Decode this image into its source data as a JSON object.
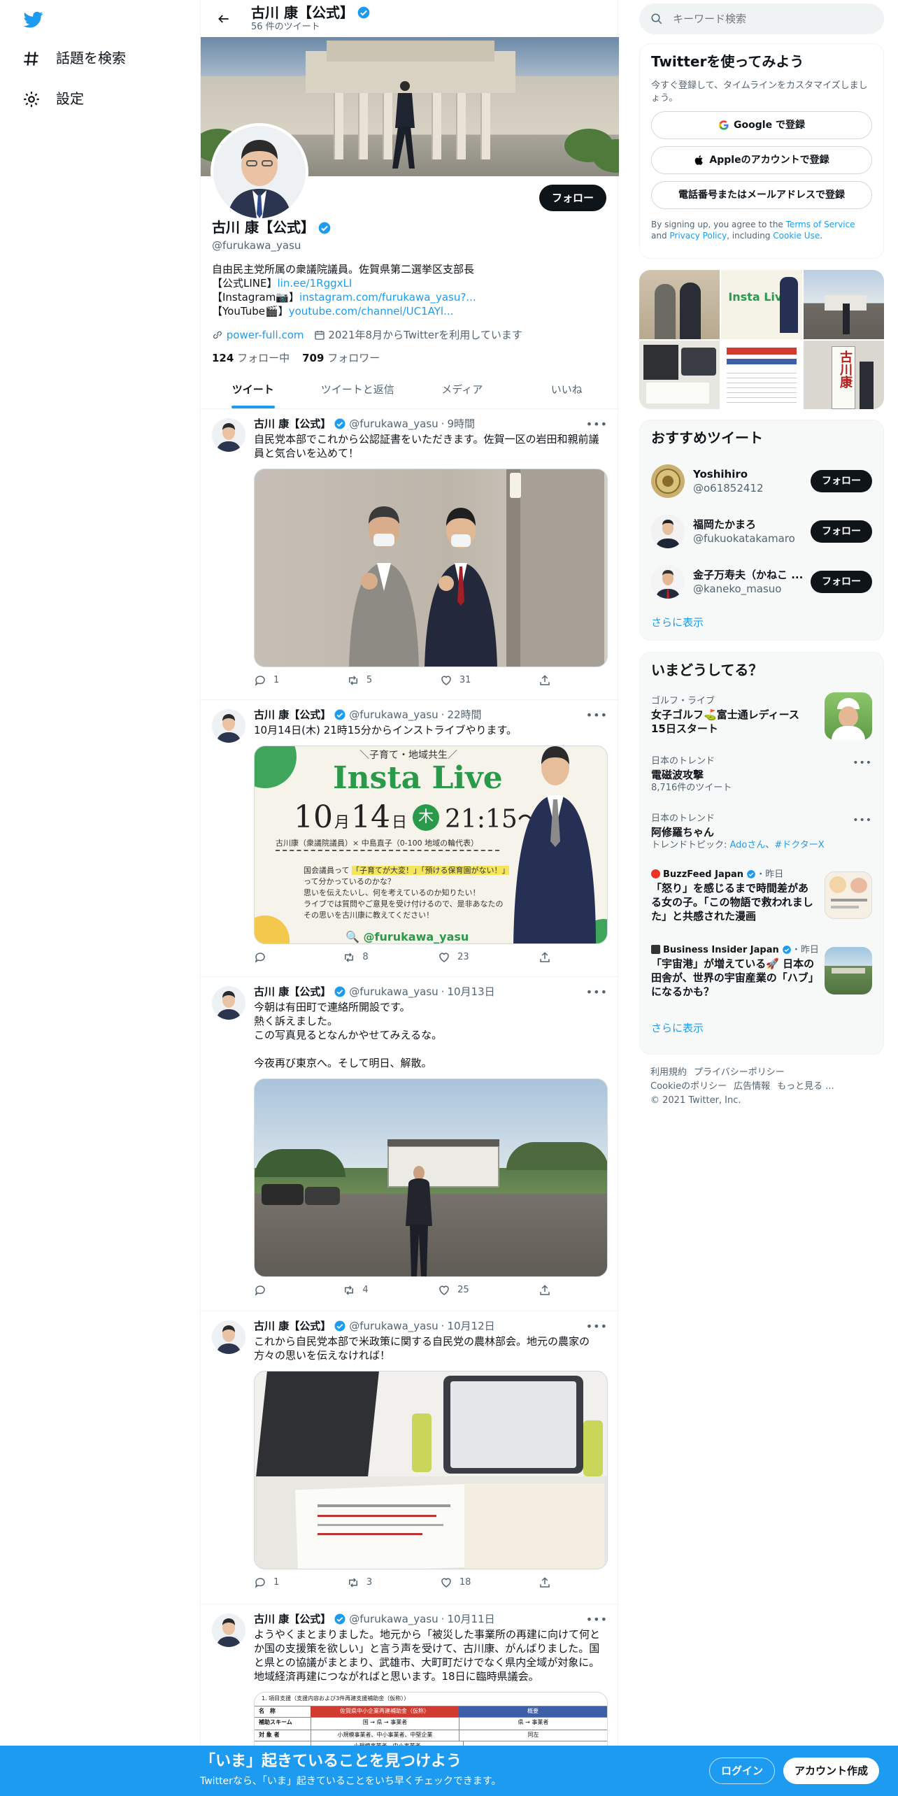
{
  "nav": {
    "explore_label": "話題を検索",
    "settings_label": "設定"
  },
  "header": {
    "name": "古川 康【公式】",
    "tweet_count": "56 件のツイート"
  },
  "profile": {
    "follow_label": "フォロー",
    "name": "古川 康【公式】",
    "handle": "@furukawa_yasu",
    "bio_line1": "自由民主党所属の衆議院議員。佐賀県第二選挙区支部長",
    "bio_line2_prefix": "【公式LINE】",
    "bio_line2_link": "lin.ee/1RggxLI",
    "bio_line3_prefix": "【Instagram📷】",
    "bio_line3_link": "instagram.com/furukawa_yasu?...",
    "bio_line4_prefix": "【YouTube🎬】",
    "bio_line4_link": "youtube.com/channel/UC1AYl...",
    "website": "power-full.com",
    "joined": "2021年8月からTwitterを利用しています",
    "following_count": "124",
    "following_label": "フォロー中",
    "followers_count": "709",
    "followers_label": "フォロワー"
  },
  "tabs": [
    "ツイート",
    "ツイートと返信",
    "メディア",
    "いいね"
  ],
  "tweets": [
    {
      "name": "古川 康【公式】",
      "handle": "@furukawa_yasu",
      "time": "9時間",
      "text": "自民党本部でこれから公認証書をいただきます。佐賀一区の岩田和親前議員と気合いを込めて！",
      "replies": "1",
      "retweets": "5",
      "likes": "31"
    },
    {
      "name": "古川 康【公式】",
      "handle": "@furukawa_yasu",
      "time": "22時間",
      "text": "10月14日(木) 21時15分からインストライブやります。",
      "replies": "",
      "retweets": "8",
      "likes": "23",
      "poster": {
        "tagline": "＼子育て・地域共生／",
        "title": "Insta Live",
        "date_month": "10",
        "month_unit": "月",
        "date_day": "14",
        "day_unit": "日",
        "weekday": "木",
        "time": "21:15〜",
        "guests": "古川康（衆議院議員）× 中島直子（0-100 地域の輪代表）",
        "body1_pre": "国会議員って",
        "body1_hl1": "「子育てが大変！」",
        "body1_hl2": "「預ける保育園がない！」",
        "body2": "って分かっているのかな？",
        "body3": "思いを伝えたいし、何を考えているのか知りたい！",
        "body4": "ライブでは質問やご意見を受け付けるので、是非あなたの",
        "body5": "その思いを古川康に教えてください！",
        "account": "@furukawa_yasu"
      }
    },
    {
      "name": "古川 康【公式】",
      "handle": "@furukawa_yasu",
      "time": "10月13日",
      "text": "今朝は有田町で連絡所開設です。\n熱く訴えました。\nこの写真見るとなんかやせてみえるな。\n\n今夜再び東京へ。そして明日、解散。",
      "replies": "",
      "retweets": "4",
      "likes": "25"
    },
    {
      "name": "古川 康【公式】",
      "handle": "@furukawa_yasu",
      "time": "10月12日",
      "text": "これから自民党本部で米政策に関する自民党の農林部会。地元の農家の方々の思いを伝えなければ！",
      "replies": "1",
      "retweets": "3",
      "likes": "18"
    },
    {
      "name": "古川 康【公式】",
      "handle": "@furukawa_yasu",
      "time": "10月11日",
      "text": "ようやくまとまりました。地元から「被災した事業所の再建に向けて何とか国の支援策を欲しい」と言う声を受けて、古川康、がんばりました。国と県との協議がまとまり、武雄市、大町町だけでなく県内全域が対象に。地域経済再建につながればと思います。18日に臨時県議会。",
      "doc_title": "1. 項目支援（支援内容および3件再建支援補助金（仮称））",
      "doc_row1": "名　称",
      "doc_row1_val": "佐賀県中小企業再建補助金（仮称）",
      "doc_row1_val2": "概要",
      "doc_row2": "補助スキーム",
      "doc_row2_val": "国 → 県 → 事業者",
      "doc_row2_val2": "県 → 事業者",
      "doc_row3": "対 象 者",
      "doc_row3_val": "小規模事業者、中小事業者、中堅企業",
      "doc_row3_val2": "同左",
      "doc_row4_val": "小規模事業者、中小事業者"
    }
  ],
  "search": {
    "placeholder": "キーワード検索"
  },
  "signup": {
    "title": "Twitterを使ってみよう",
    "subtitle": "今すぐ登録して、タイムラインをカスタマイズしましょう。",
    "google": "Google で登録",
    "apple": "Appleのアカウントで登録",
    "phone": "電話番号またはメールアドレスで登録",
    "legal_pre": "By signing up, you agree to the ",
    "terms": "Terms of Service",
    "legal_and": " and ",
    "privacy": "Privacy Policy",
    "legal_incl": ", including ",
    "cookie": "Cookie Use",
    "legal_end": "."
  },
  "media_grid_poster_text": "Insta Live",
  "media_grid_sign_text": "古川康",
  "who_to_follow": {
    "title": "おすすめツイート",
    "users": [
      {
        "name": "Yoshihiro",
        "handle": "@o61852412",
        "button": "フォロー"
      },
      {
        "name": "福岡たかまろ",
        "handle": "@fukuokatakamaro",
        "button": "フォロー"
      },
      {
        "name": "金子万寿夫（かねこ ...",
        "handle": "@kaneko_masuo",
        "button": "フォロー"
      }
    ],
    "show_more": "さらに表示"
  },
  "trends": {
    "title": "いまどうしてる？",
    "items": [
      {
        "category": "ゴルフ・ライブ",
        "title": "女子ゴルフ⛳富士通レディース 15日スタート"
      },
      {
        "category": "日本のトレンド",
        "title": "電磁波攻撃",
        "count": "8,716件のツイート"
      },
      {
        "category": "日本のトレンド",
        "title": "阿修羅ちゃん",
        "topics_label": "トレンドトピック: ",
        "topic1": "Adoさん",
        "topic2": "#ドクターX"
      },
      {
        "source": "BuzzFeed Japan",
        "time": "・昨日",
        "title": "「怒り」を感じるまで時間差がある女の子。「この物語で救われました」と共感された漫画"
      },
      {
        "source": "Business Insider Japan",
        "time": "・昨日",
        "title": "「宇宙港」が増えている🚀 日本の田舎が、世界の宇宙産業の「ハブ」になるかも？"
      }
    ],
    "show_more": "さらに表示"
  },
  "footer": {
    "terms": "利用規約",
    "privacy": "プライバシーポリシー",
    "cookie": "Cookieのポリシー",
    "ads": "広告情報",
    "more": "もっと見る ...",
    "copyright": "© 2021 Twitter, Inc."
  },
  "bottombar": {
    "title": "「いま」起きていることを見つけよう",
    "subtitle": "Twitterなら、「いま」起きていることをいち早くチェックできます。",
    "login": "ログイン",
    "signup": "アカウント作成"
  },
  "colors": {
    "accent": "#1d9bf0",
    "text": "#0f1419",
    "muted": "#536471",
    "poster_green": "#2a9a4a"
  }
}
